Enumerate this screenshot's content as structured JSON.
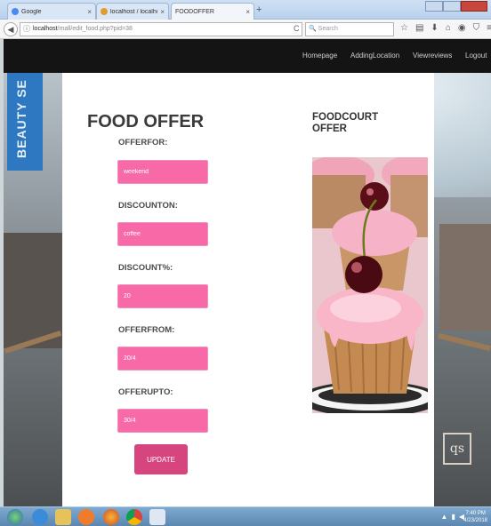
{
  "browser": {
    "tabs": [
      {
        "label": "Google",
        "fav_color": "#4a8af4"
      },
      {
        "label": "localhost / localhost / mall...",
        "fav_color": "#e39b2c"
      },
      {
        "label": "FOODOFFER",
        "fav_color": "#ffffff"
      }
    ],
    "new_tab_glyph": "+",
    "url_host": "localhost",
    "url_path": "/mall/edit_food.php?pid=38",
    "search_placeholder": "Search",
    "toolbar_icons": [
      "star-icon",
      "reading-list-icon",
      "download-icon",
      "home-icon",
      "pocket-icon",
      "shield-icon",
      "menu-icon"
    ]
  },
  "site": {
    "nav": [
      "Homepage",
      "AddingLocation",
      "Viewreviews",
      "Logout"
    ],
    "background_sign": "BEAUTY SE",
    "store_sign": "qs"
  },
  "form": {
    "title": "FOOD OFFER",
    "fields": [
      {
        "label": "OFFERFOR:",
        "value": "weekend"
      },
      {
        "label": "DISCOUNTON:",
        "value": "coffee"
      },
      {
        "label": "DISCOUNT%:",
        "value": "20"
      },
      {
        "label": "OFFERFROM:",
        "value": "20/4"
      },
      {
        "label": "OFFERUPTO:",
        "value": "30/4"
      }
    ],
    "submit_label": "UPDATE"
  },
  "sidebar": {
    "title": "FOODCOURT OFFER"
  },
  "taskbar": {
    "time": "7:40 PM",
    "date": "4/23/2018"
  },
  "colors": {
    "accent": "#f76aa7",
    "button": "#d6457e",
    "nav_bg": "#141414"
  }
}
